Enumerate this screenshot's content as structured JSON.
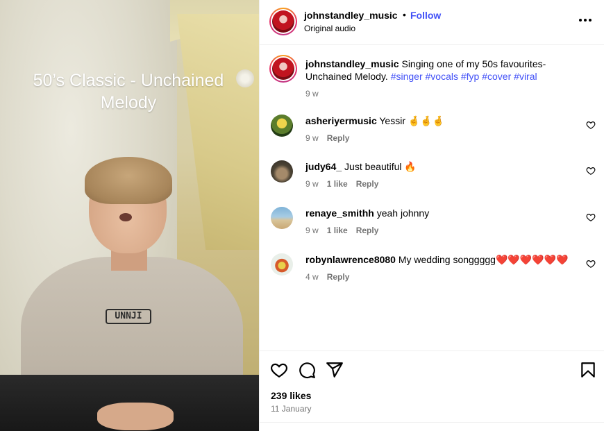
{
  "video": {
    "overlay_text": "50’s Classic - Unchained Melody",
    "shirt_print": "UNNJI"
  },
  "header": {
    "username": "johnstandley_music",
    "separator": "•",
    "follow_label": "Follow",
    "audio_label": "Original audio"
  },
  "caption": {
    "username": "johnstandley_music",
    "text": "Singing one of my 50s favourites- Unchained Melody.",
    "hashtags": [
      "#singer",
      "#vocals",
      "#fyp",
      "#cover",
      "#viral"
    ],
    "time": "9 w"
  },
  "comments": [
    {
      "username": "asheriyermusic",
      "text": "Yessir 🤞🤞🤞",
      "time": "9 w",
      "likes": "",
      "reply_label": "Reply"
    },
    {
      "username": "judy64_",
      "text": "Just beautiful 🔥",
      "time": "9 w",
      "likes": "1 like",
      "reply_label": "Reply"
    },
    {
      "username": "renaye_smithh",
      "text": "yeah johnny",
      "time": "9 w",
      "likes": "1 like",
      "reply_label": "Reply"
    },
    {
      "username": "robynlawrence8080",
      "text": "My wedding songgggg❤️❤️❤️❤️❤️❤️",
      "time": "4 w",
      "likes": "",
      "reply_label": "Reply"
    }
  ],
  "footer": {
    "likes": "239 likes",
    "date": "11 January"
  },
  "icons": {
    "more": "more-options-icon",
    "like": "heart-icon",
    "comment": "comment-icon",
    "share": "share-icon",
    "save": "bookmark-icon"
  },
  "colors": {
    "accent": "#4150f7",
    "muted": "#737373",
    "divider": "#efefef"
  }
}
